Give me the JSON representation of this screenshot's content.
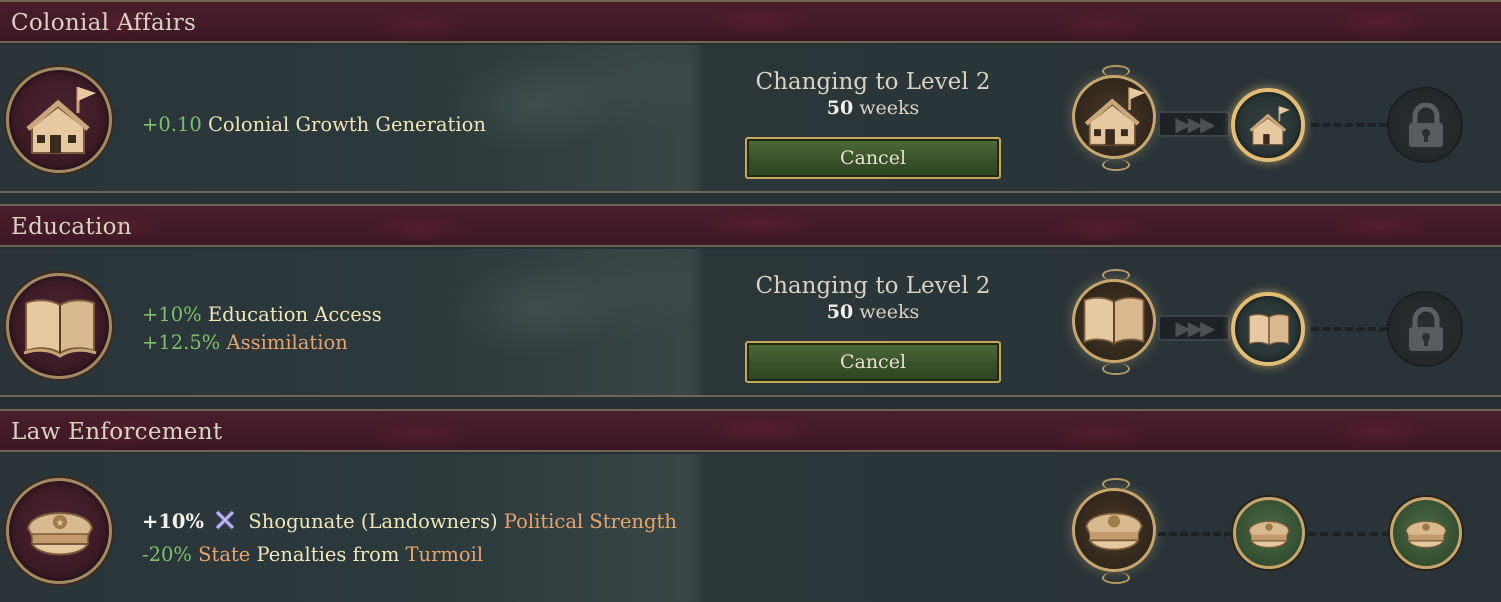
{
  "sections": [
    {
      "title": "Colonial Affairs",
      "icon": "house-flag-icon",
      "modifiers": [
        {
          "value": "+0.10",
          "label": "Colonial Growth Generation"
        }
      ],
      "status": {
        "changing": "Changing to Level 2",
        "duration_value": "50",
        "duration_unit": "weeks",
        "cancel": "Cancel"
      },
      "levels": [
        "current",
        "next",
        "locked"
      ]
    },
    {
      "title": "Education",
      "icon": "open-book-icon",
      "modifiers": [
        {
          "value": "+10%",
          "label": "Education Access"
        },
        {
          "value": "+12.5%",
          "label": "Assimilation"
        }
      ],
      "status": {
        "changing": "Changing to Level 2",
        "duration_value": "50",
        "duration_unit": "weeks",
        "cancel": "Cancel"
      },
      "levels": [
        "current",
        "next",
        "locked"
      ]
    },
    {
      "title": "Law Enforcement",
      "icon": "police-cap-icon",
      "modifiers": [
        {
          "value": "+10%",
          "group_icon": "shogunate-icon",
          "group": "Shogunate (Landowners)",
          "label": "Political Strength"
        },
        {
          "value": "-20%",
          "prefix": "State",
          "label": "Penalties from",
          "suffix": "Turmoil"
        }
      ],
      "levels": [
        "current",
        "available",
        "available"
      ]
    }
  ],
  "colors": {
    "header_bg": "#4a1d2b",
    "body_bg": "#263036",
    "positive": "#7ec06e",
    "highlight": "#e7a46d",
    "text": "#f0e6b8",
    "gold": "#c7a66e"
  }
}
